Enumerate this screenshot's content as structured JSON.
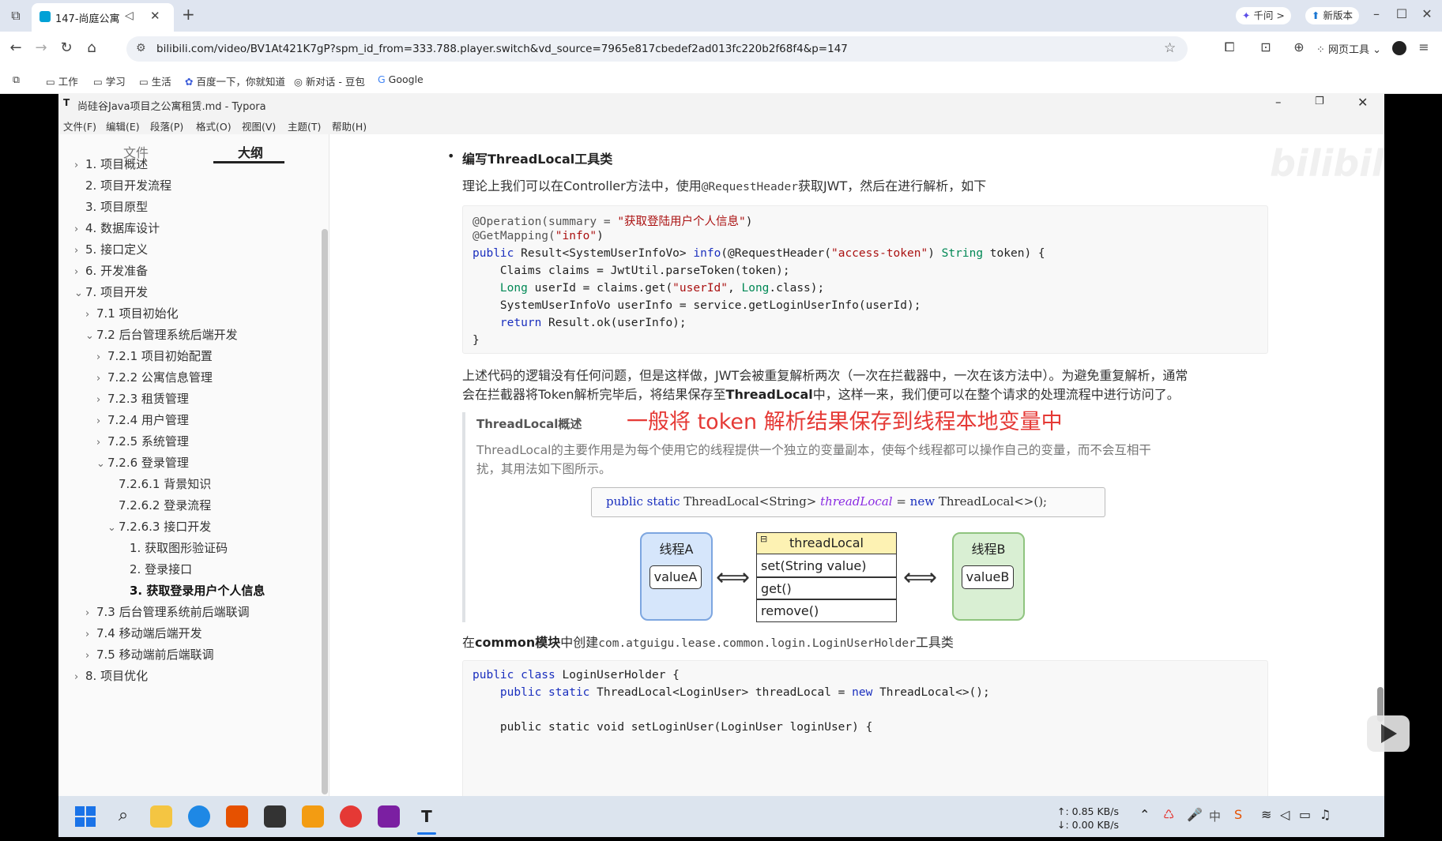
{
  "browser": {
    "tab_title": "147-尚庭公寓",
    "qianwen_label": "千问 >",
    "new_version_label": "新版本",
    "url": "bilibili.com/video/BV1At421K7gP?spm_id_from=333.788.player.switch&vd_source=7965e817cbedef2ad013fc220b2f68f4&p=147",
    "web_tools_label": "网页工具",
    "bookmarks": [
      "工作",
      "学习",
      "生活",
      "百度一下，你就知道",
      "新对话 - 豆包",
      "Google"
    ]
  },
  "typora": {
    "window_title": "尚硅谷Java项目之公寓租赁.md - Typora",
    "menu": [
      "文件(F)",
      "编辑(E)",
      "段落(P)",
      "格式(O)",
      "视图(V)",
      "主题(T)",
      "帮助(H)"
    ],
    "sidebar_tabs": {
      "files": "文件",
      "outline": "大纲"
    },
    "outline": [
      {
        "label": "1. 项目概述",
        "caret": "›"
      },
      {
        "label": "2. 项目开发流程",
        "caret": ""
      },
      {
        "label": "3. 项目原型",
        "caret": ""
      },
      {
        "label": "4. 数据库设计",
        "caret": "›"
      },
      {
        "label": "5. 接口定义",
        "caret": "›"
      },
      {
        "label": "6. 开发准备",
        "caret": "›"
      },
      {
        "label": "7. 项目开发",
        "caret": "⌄"
      },
      {
        "label": "7.1 项目初始化",
        "caret": "›"
      },
      {
        "label": "7.2 后台管理系统后端开发",
        "caret": "⌄"
      },
      {
        "label": "7.2.1 项目初始配置",
        "caret": "›"
      },
      {
        "label": "7.2.2 公寓信息管理",
        "caret": "›"
      },
      {
        "label": "7.2.3 租赁管理",
        "caret": "›"
      },
      {
        "label": "7.2.4 用户管理",
        "caret": "›"
      },
      {
        "label": "7.2.5 系统管理",
        "caret": "›"
      },
      {
        "label": "7.2.6 登录管理",
        "caret": "⌄"
      },
      {
        "label": "7.2.6.1 背景知识",
        "caret": ""
      },
      {
        "label": "7.2.6.2 登录流程",
        "caret": ""
      },
      {
        "label": "7.2.6.3 接口开发",
        "caret": "⌄"
      },
      {
        "label": "1. 获取图形验证码",
        "caret": ""
      },
      {
        "label": "2. 登录接口",
        "caret": ""
      },
      {
        "label": "3. 获取登录用户个人信息",
        "caret": ""
      },
      {
        "label": "7.3 后台管理系统前后端联调",
        "caret": "›"
      },
      {
        "label": "7.4 移动端后端开发",
        "caret": "›"
      },
      {
        "label": "7.5 移动端前后端联调",
        "caret": "›"
      },
      {
        "label": "8. 项目优化",
        "caret": "›"
      }
    ],
    "content": {
      "bullet_heading": "编写ThreadLocal工具类",
      "para1_prefix": "理论上我们可以在Controller方法中，使用",
      "para1_code": "@RequestHeader",
      "para1_suffix": "获取JWT，然后在进行解析，如下",
      "code1": {
        "l1a": "@Operation(summary = ",
        "l1b": "\"获取登陆用户个人信息\"",
        "l1c": ")",
        "l2a": "@GetMapping(",
        "l2b": "\"info\"",
        "l2c": ")",
        "l3a": "public",
        "l3b": " Result<SystemUserInfoVo> ",
        "l3c": "info",
        "l3d": "(@RequestHeader(",
        "l3e": "\"access-token\"",
        "l3f": ") ",
        "l3g": "String",
        "l3h": " token) {",
        "l4": "    Claims claims = JwtUtil.parseToken(token);",
        "l5a": "    Long",
        "l5b": " userId = claims.get(",
        "l5c": "\"userId\"",
        "l5d": ", ",
        "l5e": "Long",
        "l5f": ".class);",
        "l6": "    SystemUserInfoVo userInfo = service.getLoginUserInfo(userId);",
        "l7a": "    return",
        "l7b": " Result.ok(userInfo);",
        "l8": "}"
      },
      "para2_line1": "上述代码的逻辑没有任何问题，但是这样做，JWT会被重复解析两次（一次在拦截器中，一次在该方法中）。为避免重复解析，通常",
      "para2_line2_a": "会在拦截器将Token解析完毕后，将结果保存至",
      "para2_line2_b": "ThreadLocal",
      "para2_line2_c": "中，这样一来，我们便可以在整个请求的处理流程中进行访问了。",
      "quote_title": "ThreadLocal概述",
      "quote_line1": "ThreadLocal的主要作用是为每个使用它的线程提供一个独立的变量副本，使每个线程都可以操作自己的变量，而不会互相干",
      "quote_line2": "扰，其用法如下图所示。",
      "annotation": "一般将 token 解析结果保存到线程本地变量中",
      "decl": {
        "kw1": "public static",
        "t1": " ThreadLocal<String> ",
        "var": "threadLocal",
        "eq": " = ",
        "kw2": "new",
        "t2": " ThreadLocal<>();"
      },
      "diagram": {
        "thread_a": "线程A",
        "value_a": "valueA",
        "thread_b": "线程B",
        "value_b": "valueB",
        "class_name": "threadLocal",
        "methods": [
          "set(String value)",
          "get()",
          "remove()"
        ]
      },
      "para3_a": "在",
      "para3_b": "common模块",
      "para3_c": "中创建",
      "para3_code": "com.atguigu.lease.common.login.LoginUserHolder",
      "para3_d": "工具类",
      "code2": {
        "l1a": "public class",
        "l1b": " LoginUserHolder {",
        "l2a": "    public static",
        "l2b": " ThreadLocal<LoginUser> threadLocal = ",
        "l2c": "new",
        "l2d": " ThreadLocal<>();",
        "l3": "    public static void setLoginUser(LoginUser loginUser) {"
      }
    }
  },
  "watermark": "bilibili",
  "taskbar": {
    "net_up": "↑: 0.85 KB/s",
    "net_down": "↓: 0.00 KB/s",
    "ime_label": "中"
  },
  "colors": {
    "annotation": "#e53935",
    "thread_a_bg": "#d6e6fb",
    "thread_b_bg": "#d9efd3",
    "class_header_bg": "#fdf2b3"
  }
}
